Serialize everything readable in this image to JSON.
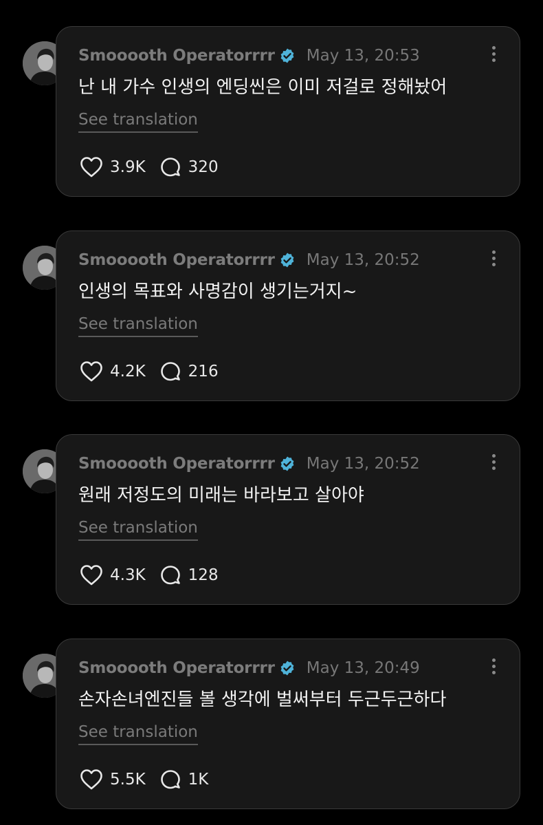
{
  "posts": [
    {
      "author": "Smooooth Operatorrrr",
      "time": "May 13, 20:53",
      "text": "난 내 가수 인생의 엔딩씬은 이미 저걸로 정해놨어",
      "translate_label": "See translation",
      "likes": "3.9K",
      "comments": "320"
    },
    {
      "author": "Smooooth Operatorrrr",
      "time": "May 13, 20:52",
      "text": "인생의 목표와 사명감이 생기는거지~",
      "translate_label": "See translation",
      "likes": "4.2K",
      "comments": "216"
    },
    {
      "author": "Smooooth Operatorrrr",
      "time": "May 13, 20:52",
      "text": "원래 저정도의 미래는 바라보고 살아야",
      "translate_label": "See translation",
      "likes": "4.3K",
      "comments": "128"
    },
    {
      "author": "Smooooth Operatorrrr",
      "time": "May 13, 20:49",
      "text": "손자손녀엔진들 볼 생각에 벌써부터 두근두근하다",
      "translate_label": "See translation",
      "likes": "5.5K",
      "comments": "1K"
    }
  ],
  "icons": {
    "verified": "verified-badge-icon",
    "like": "heart-icon",
    "comment": "comment-bubble-icon",
    "more": "more-vertical-icon"
  },
  "colors": {
    "background": "#000000",
    "card": "#181818",
    "verified_badge": "#4fb3d9",
    "text": "#f2f2f2",
    "muted": "#7a7a7a"
  }
}
